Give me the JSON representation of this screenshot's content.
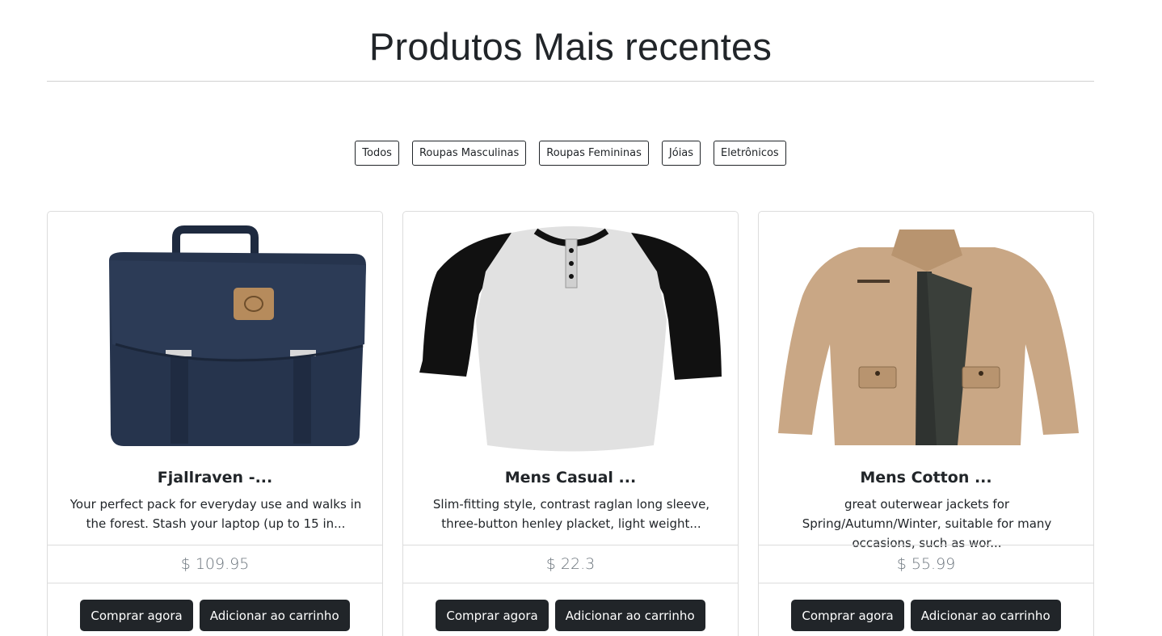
{
  "heading": "Produtos Mais recentes",
  "filters": [
    "Todos",
    "Roupas Masculinas",
    "Roupas Femininas",
    "Jóias",
    "Eletrônicos"
  ],
  "products": [
    {
      "title": "Fjallraven -...",
      "description": "Your perfect pack for everyday use and walks in the forest. Stash your laptop (up to 15 in...",
      "price": "$ 109.95",
      "image": "backpack-image",
      "buy_label": "Comprar agora",
      "cart_label": "Adicionar ao carrinho"
    },
    {
      "title": "Mens Casual ...",
      "description": "Slim-fitting style, contrast raglan long sleeve, three-button henley placket, light weight...",
      "price": "$ 22.3",
      "image": "tshirt-image",
      "buy_label": "Comprar agora",
      "cart_label": "Adicionar ao carrinho"
    },
    {
      "title": "Mens Cotton ...",
      "description": "great outerwear jackets for Spring/Autumn/Winter, suitable for many occasions, such as wor...",
      "price": "$ 55.99",
      "image": "jacket-image",
      "buy_label": "Comprar agora",
      "cart_label": "Adicionar ao carrinho"
    }
  ],
  "colors": {
    "text": "#212529",
    "muted": "#6c757d",
    "button_dark": "#212529",
    "border": "#dcdcdc",
    "backpack": "#26344d",
    "jacket": "#c9a785"
  }
}
